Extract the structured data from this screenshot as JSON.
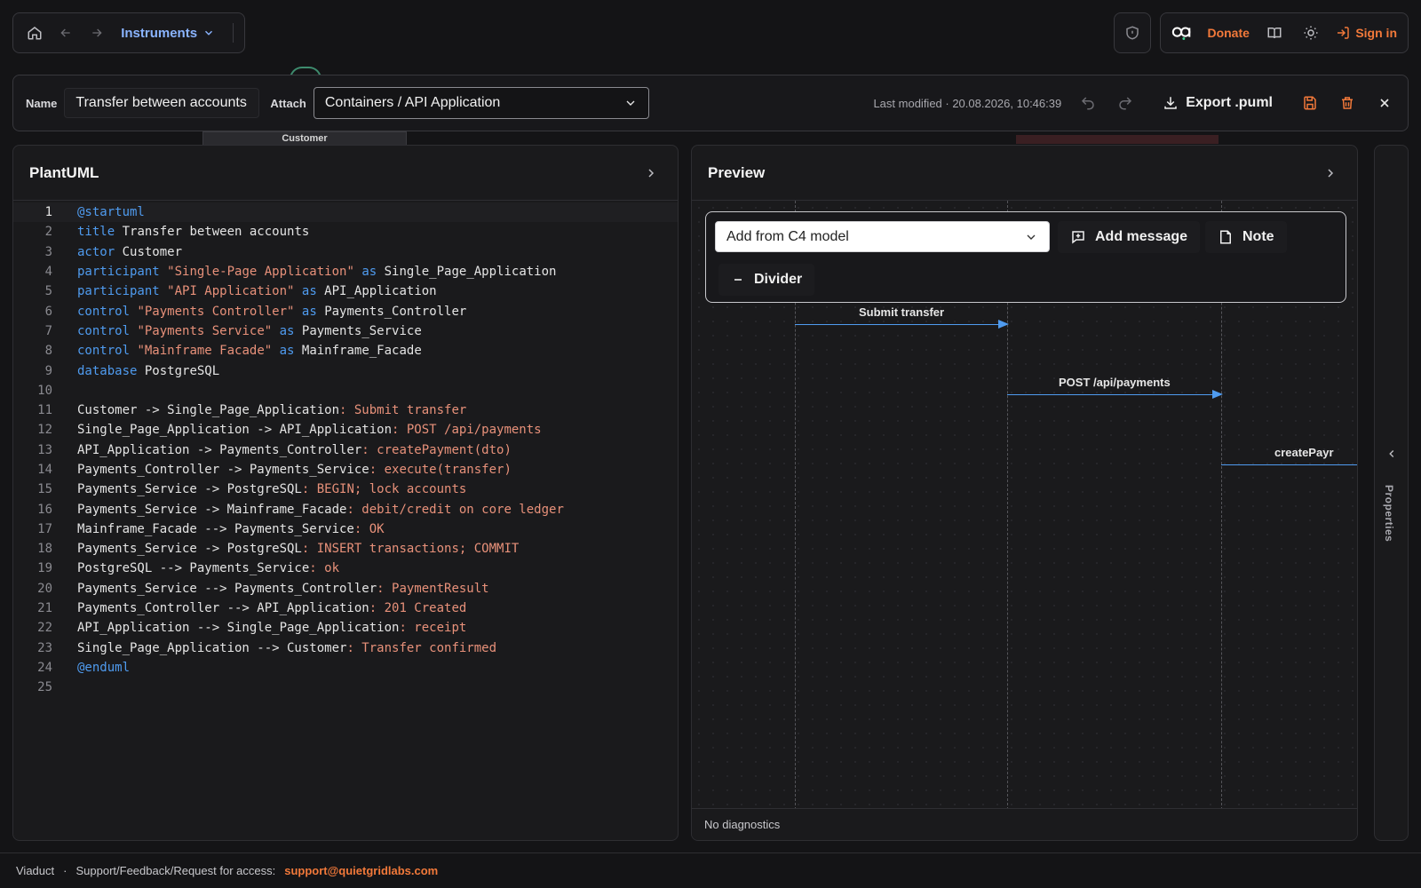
{
  "topbar": {
    "breadcrumb": "Instruments",
    "donate": "Donate",
    "signin": "Sign in",
    "icons": [
      "home-icon",
      "arrow-left-icon",
      "arrow-right-icon",
      "chevron-down-icon",
      "shield-icon",
      "logo-icon",
      "book-icon",
      "sun-icon",
      "sign-in-icon"
    ]
  },
  "background": {
    "node_label": "Customer"
  },
  "toolbar": {
    "name_label": "Name",
    "name_value": "Transfer between accounts",
    "attach_label": "Attach",
    "attach_value": "Containers / API Application",
    "last_modified": "Last modified · 20.08.2026, 10:46:39",
    "export_label": "Export .puml"
  },
  "editor": {
    "title": "PlantUML",
    "active_line": 1,
    "lines": [
      "@startuml",
      "title Transfer between accounts",
      "actor Customer",
      "participant \"Single-Page Application\" as Single_Page_Application",
      "participant \"API Application\" as API_Application",
      "control \"Payments Controller\" as Payments_Controller",
      "control \"Payments Service\" as Payments_Service",
      "control \"Mainframe Facade\" as Mainframe_Facade",
      "database PostgreSQL",
      "",
      "Customer -> Single_Page_Application: Submit transfer",
      "Single_Page_Application -> API_Application: POST /api/payments",
      "API_Application -> Payments_Controller: createPayment(dto)",
      "Payments_Controller -> Payments_Service: execute(transfer)",
      "Payments_Service -> PostgreSQL: BEGIN; lock accounts",
      "Payments_Service -> Mainframe_Facade: debit/credit on core ledger",
      "Mainframe_Facade --> Payments_Service: OK",
      "Payments_Service -> PostgreSQL: INSERT transactions; COMMIT",
      "PostgreSQL --> Payments_Service: ok",
      "Payments_Service --> Payments_Controller: PaymentResult",
      "Payments_Controller --> API_Application: 201 Created",
      "API_Application --> Single_Page_Application: receipt",
      "Single_Page_Application --> Customer: Transfer confirmed",
      "@enduml",
      ""
    ]
  },
  "preview": {
    "title": "Preview",
    "palette": {
      "select_value": "Add from C4 model",
      "add_message": "Add message",
      "note": "Note",
      "divider": "Divider"
    },
    "messages": [
      {
        "label": "Submit transfer"
      },
      {
        "label": "POST /api/payments"
      },
      {
        "label": "createPayr"
      }
    ],
    "zoom_level": 0.55,
    "diagnostics": "No diagnostics"
  },
  "properties": {
    "label": "Properties"
  },
  "footer": {
    "app": "Viaduct",
    "separator": "·",
    "support_text": "Support/Feedback/Request for access:",
    "email": "support@quietgridlabs.com"
  },
  "colors": {
    "accent": "#f2793a",
    "link": "#8ab4ff",
    "keyword": "#4f9bef",
    "string": "#e8917a"
  }
}
